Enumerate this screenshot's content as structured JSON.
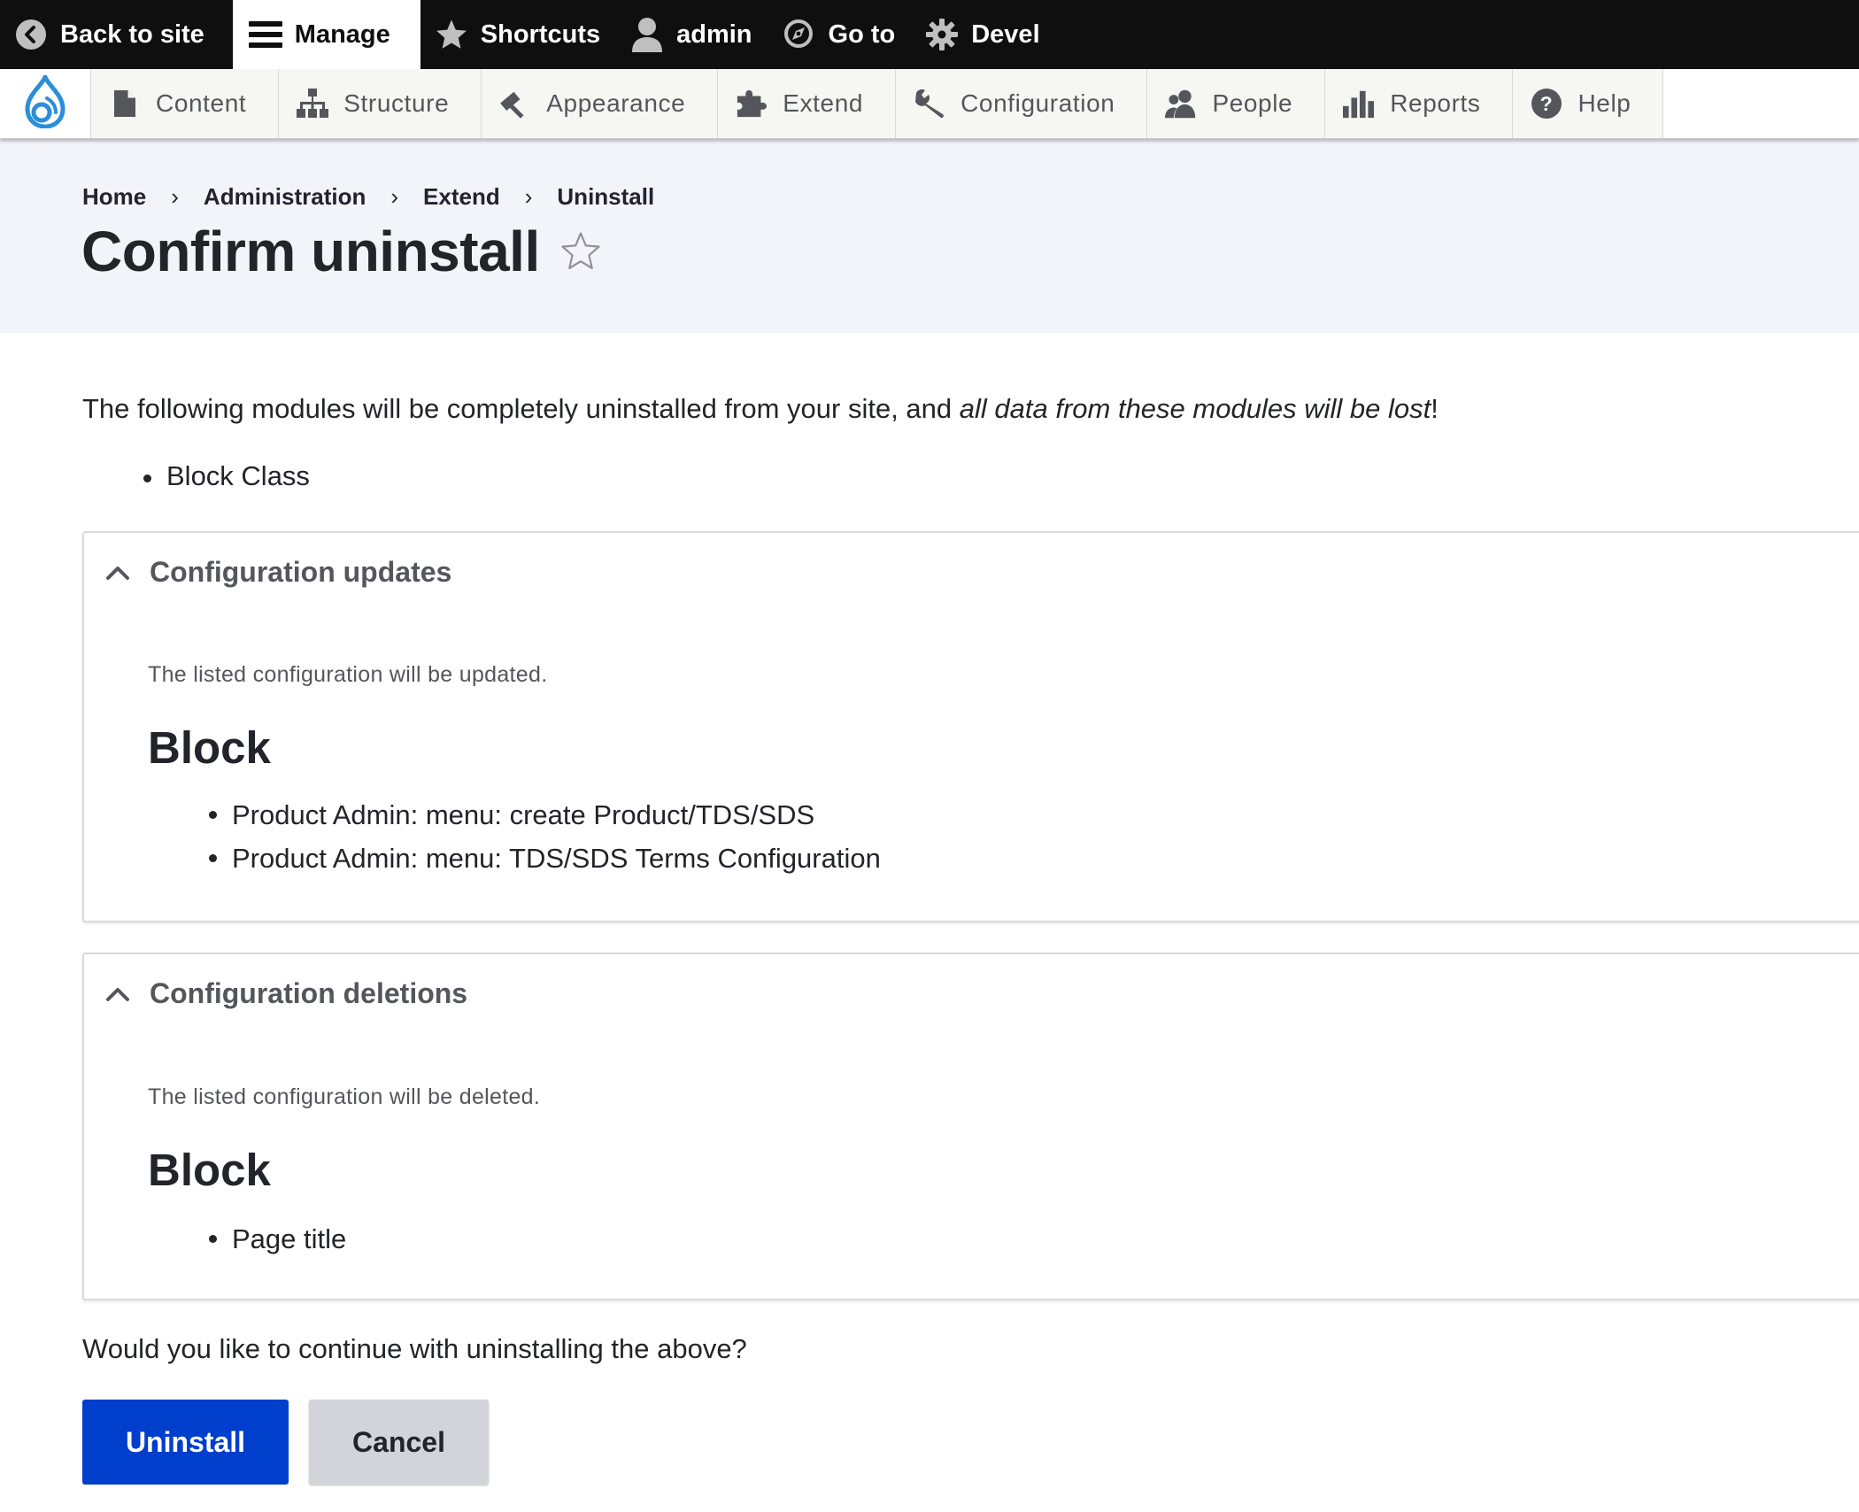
{
  "toolbar": {
    "back_to_site": "Back to site",
    "manage": "Manage",
    "shortcuts": "Shortcuts",
    "user": "admin",
    "go_to": "Go to",
    "devel": "Devel"
  },
  "tray": {
    "items": [
      {
        "label": "Content",
        "icon": "file-icon"
      },
      {
        "label": "Structure",
        "icon": "sitemap-icon"
      },
      {
        "label": "Appearance",
        "icon": "paint-roller-icon"
      },
      {
        "label": "Extend",
        "icon": "puzzle-icon"
      },
      {
        "label": "Configuration",
        "icon": "wrench-icon"
      },
      {
        "label": "People",
        "icon": "people-icon"
      },
      {
        "label": "Reports",
        "icon": "bar-chart-icon"
      },
      {
        "label": "Help",
        "icon": "help-icon"
      }
    ]
  },
  "breadcrumb": [
    "Home",
    "Administration",
    "Extend",
    "Uninstall"
  ],
  "breadcrumb_separator": "›",
  "page": {
    "title": "Confirm uninstall",
    "intro_start": "The following modules will be completely uninstalled from your site, and ",
    "intro_emphasis": "all data from these modules will be lost",
    "intro_end": "!",
    "modules": [
      "Block Class"
    ],
    "question": "Would you like to continue with uninstalling the above?"
  },
  "updates": {
    "summary": "Configuration updates",
    "description": "The listed configuration will be updated.",
    "group_heading": "Block",
    "items": [
      "Product Admin: menu: create Product/TDS/SDS",
      "Product Admin: menu: TDS/SDS Terms Configuration"
    ]
  },
  "deletions": {
    "summary": "Configuration deletions",
    "description": "The listed configuration will be deleted.",
    "group_heading": "Block",
    "items": [
      "Page title"
    ]
  },
  "actions": {
    "uninstall": "Uninstall",
    "cancel": "Cancel"
  },
  "colors": {
    "toolbar_bg": "#0f0f0f",
    "header_bg": "#f3f4f9",
    "primary_button": "#003ecc",
    "secondary_button": "#d3d4d9",
    "drupal_blue": "#2b8ed8"
  }
}
